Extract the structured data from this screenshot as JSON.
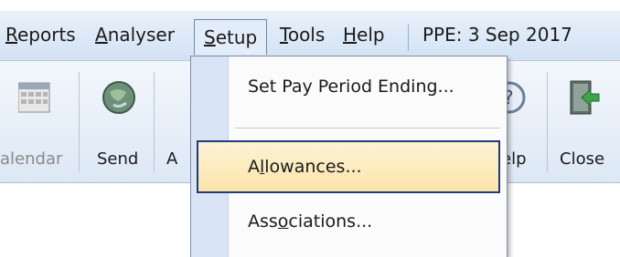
{
  "menubar": {
    "items": [
      {
        "pre": "",
        "u": "R",
        "post": "eports"
      },
      {
        "pre": "",
        "u": "A",
        "post": "nalyser"
      },
      {
        "pre": "",
        "u": "S",
        "post": "etup"
      },
      {
        "pre": "",
        "u": "T",
        "post": "ools"
      },
      {
        "pre": "",
        "u": "H",
        "post": "elp"
      }
    ],
    "ppe": "PPE: 3 Sep 2017"
  },
  "toolbar": {
    "calendar_label": "alendar",
    "send_label": "Send",
    "partial_label": "A",
    "help_label": "elp",
    "close_label": "Close"
  },
  "setup_menu": {
    "items": [
      {
        "pre": "Set Pay Period Ending...",
        "u": "",
        "post": ""
      },
      {
        "pre": "A",
        "u": "l",
        "post": "lowances..."
      },
      {
        "pre": "Ass",
        "u": "o",
        "post": "ciations..."
      }
    ]
  },
  "icons": [
    "calendar-icon",
    "globe-send-icon",
    "help-icon",
    "close-door-icon"
  ],
  "colors": {
    "menubar_bg": "#dbe7f6",
    "highlight_bg": "#fbe4a8",
    "highlight_border": "#213a78"
  }
}
